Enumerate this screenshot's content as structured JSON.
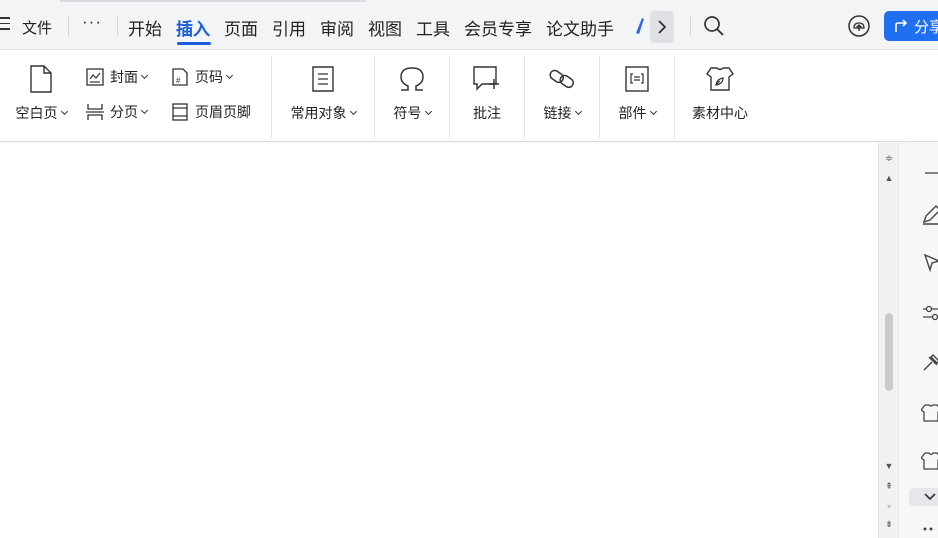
{
  "titlebar": {
    "file_label": "文件",
    "more_label": "···",
    "tabs": [
      {
        "label": "开始",
        "active": false
      },
      {
        "label": "插入",
        "active": true
      },
      {
        "label": "页面",
        "active": false
      },
      {
        "label": "引用",
        "active": false
      },
      {
        "label": "审阅",
        "active": false
      },
      {
        "label": "视图",
        "active": false
      },
      {
        "label": "工具",
        "active": false
      },
      {
        "label": "会员专享",
        "active": false
      },
      {
        "label": "论文助手",
        "active": false
      }
    ],
    "share_label": "分享"
  },
  "ribbon": {
    "blank_page": {
      "label": "空白页",
      "icon": "blank-page-icon"
    },
    "cover": {
      "label": "封面",
      "icon": "cover-icon"
    },
    "page_break": {
      "label": "分页",
      "icon": "page-break-icon"
    },
    "page_number": {
      "label": "页码",
      "icon": "page-number-icon"
    },
    "header_footer": {
      "label": "页眉页脚",
      "icon": "header-footer-icon"
    },
    "common_objects": {
      "label": "常用对象",
      "icon": "list-icon"
    },
    "symbol": {
      "label": "符号",
      "icon": "omega-icon"
    },
    "comment": {
      "label": "批注",
      "icon": "comment-icon"
    },
    "link": {
      "label": "链接",
      "icon": "link-icon"
    },
    "parts": {
      "label": "部件",
      "icon": "parts-icon"
    },
    "assets": {
      "label": "素材中心",
      "icon": "assets-icon"
    }
  },
  "colors": {
    "accent": "#1a5ed8",
    "share_button": "#1f6ff0",
    "tabbar_bg": "#f3f4f6"
  }
}
